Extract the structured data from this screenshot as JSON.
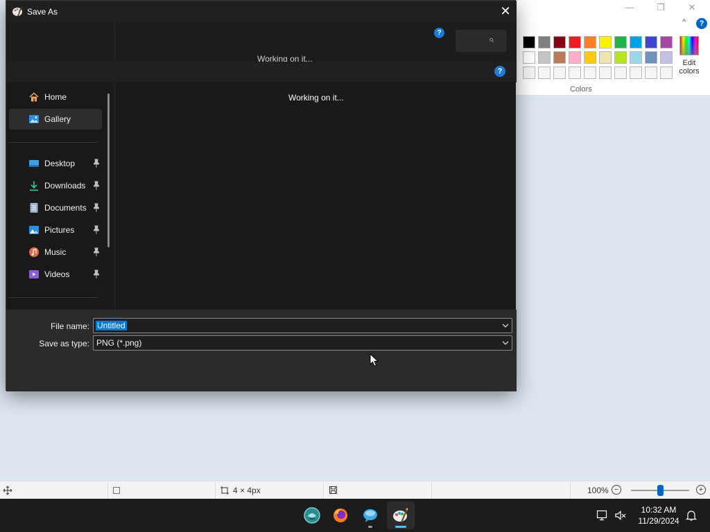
{
  "paint": {
    "window_controls": {
      "minimize": "—",
      "maximize": "❐",
      "close": "✕"
    },
    "collapse_ribbon": "^",
    "help": "?",
    "colors_label": "Colors",
    "edit_colors_line1": "Edit",
    "edit_colors_line2": "colors",
    "palette": [
      "#000000",
      "#7f7f7f",
      "#880015",
      "#ed1c24",
      "#ff7f27",
      "#fff200",
      "#22b14c",
      "#00a2e8",
      "#3f48cc",
      "#a349a4",
      "#ffffff",
      "#c3c3c3",
      "#b97a57",
      "#ffaec9",
      "#ffc90e",
      "#efe4b0",
      "#b5e61d",
      "#99d9ea",
      "#7092be",
      "#c8bfe7",
      "#f5f5f5",
      "#f5f5f5",
      "#f5f5f5",
      "#f5f5f5",
      "#f5f5f5",
      "#f5f5f5",
      "#f5f5f5",
      "#f5f5f5",
      "#f5f5f5",
      "#f5f5f5"
    ],
    "status_bar": {
      "canvas_size": "4 × 4px",
      "zoom": "100%",
      "zoom_level": 0.5
    }
  },
  "dialog": {
    "title": "Save As",
    "close_glyph": "✕",
    "help": "?",
    "ghost_working": "Working on it...",
    "working_text": "Working on it...",
    "nav": {
      "top": [
        {
          "label": "Home",
          "icon": "home-icon"
        },
        {
          "label": "Gallery",
          "icon": "gallery-icon",
          "selected": true
        }
      ],
      "pinned": [
        {
          "label": "Desktop",
          "icon": "desktop-icon"
        },
        {
          "label": "Downloads",
          "icon": "downloads-icon"
        },
        {
          "label": "Documents",
          "icon": "documents-icon"
        },
        {
          "label": "Pictures",
          "icon": "pictures-icon"
        },
        {
          "label": "Music",
          "icon": "music-icon"
        },
        {
          "label": "Videos",
          "icon": "videos-icon"
        }
      ]
    },
    "file_name_label": "File name:",
    "file_name_value": "Untitled",
    "save_type_label": "Save as type:",
    "save_type_value": "PNG (*.png)"
  },
  "taskbar": {
    "time": "10:32 AM",
    "date": "11/29/2024",
    "apps": [
      "start-app-icon",
      "firefox-icon",
      "chat-app-icon",
      "paint-icon"
    ]
  },
  "colors": {
    "dialog_bg": "#191919",
    "bottom_panel": "#2b2b2b",
    "accent": "#0078d4",
    "help_blue": "#1f7ad6"
  }
}
